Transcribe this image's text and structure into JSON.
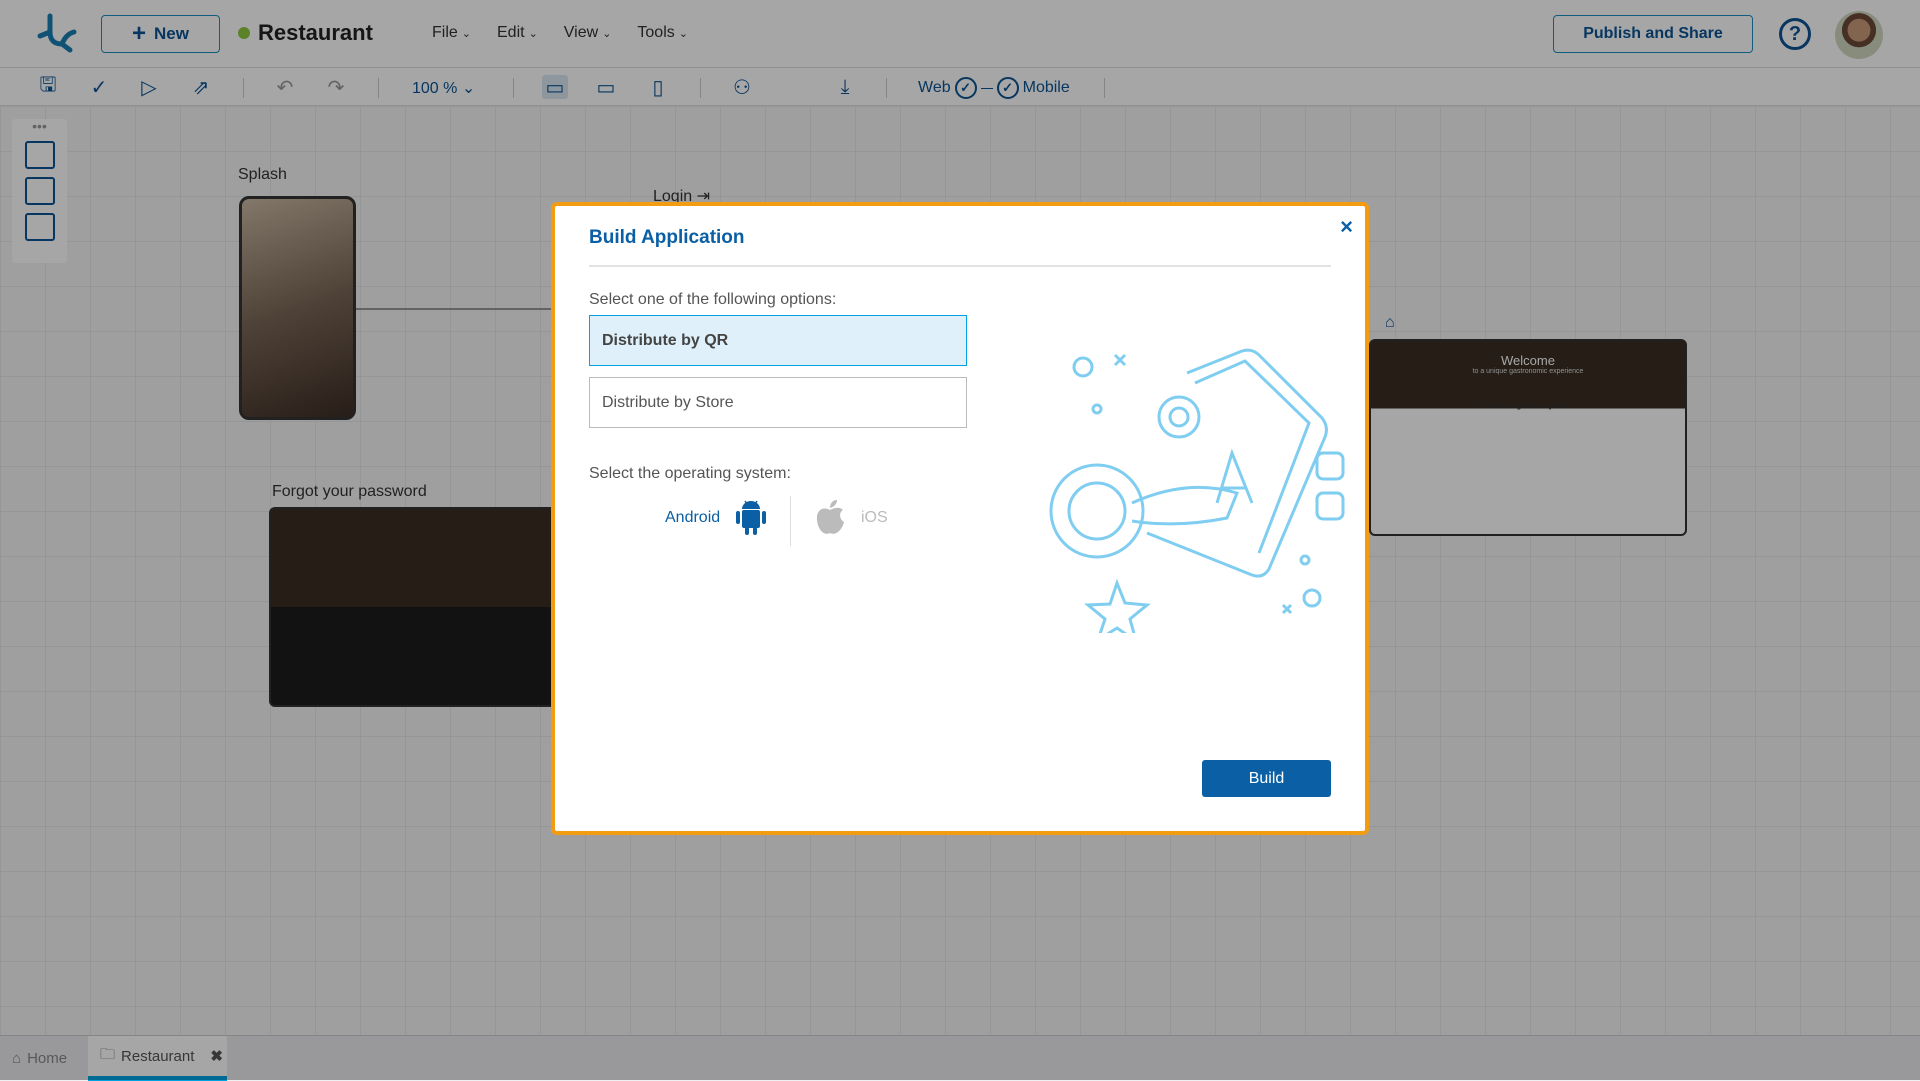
{
  "header": {
    "new_label": "New",
    "project_name": "Restaurant",
    "menu": [
      "File",
      "Edit",
      "View",
      "Tools"
    ],
    "publish_label": "Publish and Share",
    "help": "?"
  },
  "toolbar": {
    "zoom": "100 %",
    "web": "Web",
    "mobile": "Mobile"
  },
  "canvas": {
    "splash": "Splash",
    "login": "Login",
    "forgot": "Forgot your password",
    "welcome": "Welcome",
    "welcome_sub": "to a unique gastronomic experience",
    "something": "Something for everyone..."
  },
  "dialog": {
    "title": "Build Application",
    "close": "×",
    "prompt": "Select one of the following options:",
    "options": [
      "Distribute by QR",
      "Distribute by Store"
    ],
    "selected": "Distribute by QR",
    "os_prompt": "Select the operating system:",
    "os": {
      "android": "Android",
      "ios": "iOS"
    },
    "build": "Build"
  },
  "tabs": {
    "home": "Home",
    "restaurant": "Restaurant"
  },
  "colors": {
    "accent": "#0b5fa5",
    "dialog_border": "#f39c12",
    "selected_bg": "#dff0fa",
    "tab_active": "#00a3e0",
    "illustration": "#7fcdf0"
  }
}
